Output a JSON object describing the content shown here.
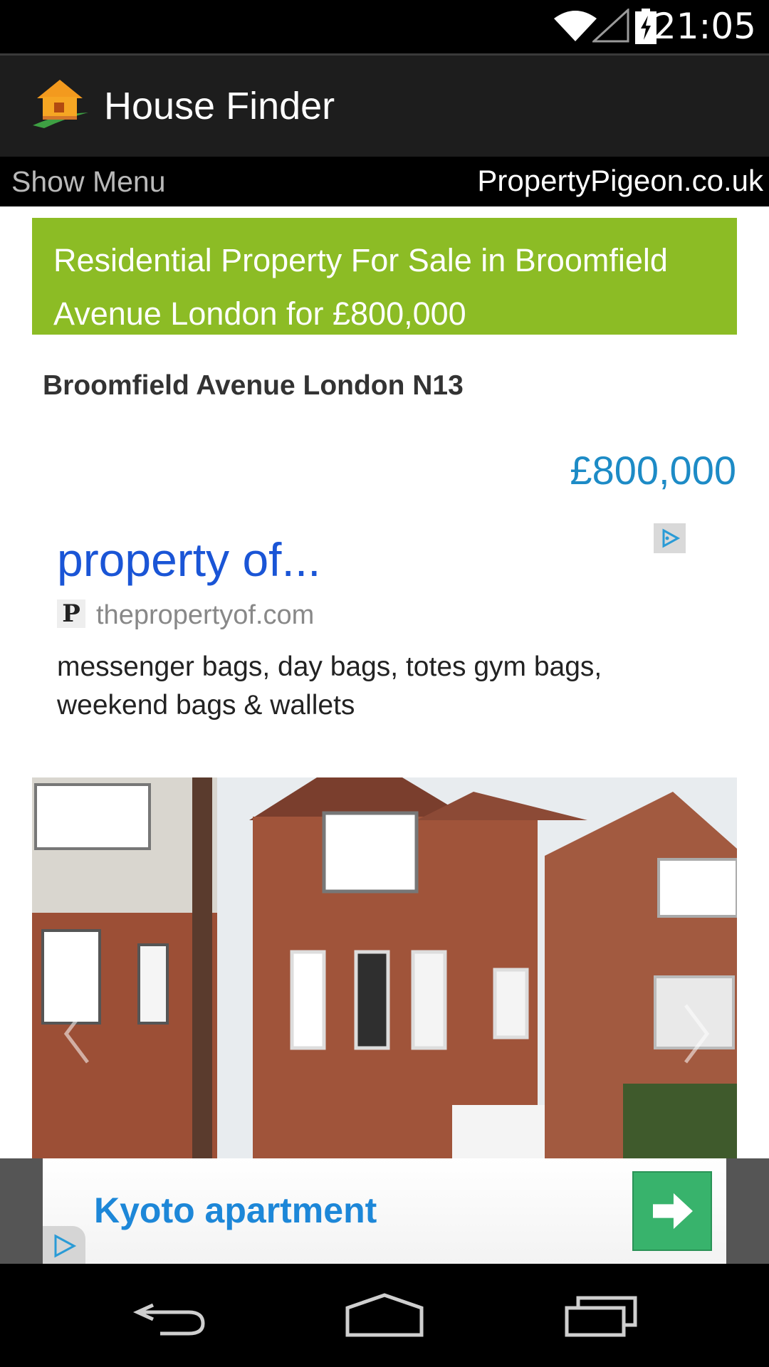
{
  "status_bar": {
    "time": "21:05",
    "icons": [
      "wifi-icon",
      "signal-icon",
      "battery-charging-icon"
    ]
  },
  "action_bar": {
    "title": "House Finder",
    "logo_icon": "house-logo-icon"
  },
  "menu_bar": {
    "show_menu_label": "Show Menu",
    "site_link": "PropertyPigeon.co.uk"
  },
  "listing": {
    "headline": "Residential Property For Sale in Broomfield Avenue London for £800,000",
    "address": "Broomfield Avenue London N13",
    "price": "£800,000",
    "photo_nav_icons": [
      "chevron-left-icon",
      "chevron-right-icon"
    ]
  },
  "ad": {
    "title": "property of...",
    "favicon_letter": "P",
    "domain": "thepropertyof.com",
    "description": "messenger bags, day bags, totes gym bags, weekend bags & wallets",
    "badge_icon": "adchoices-icon"
  },
  "banner_ad": {
    "text": "Kyoto apartment",
    "arrow_icon": "arrow-right-icon",
    "ad_icon": "adchoices-icon"
  },
  "nav_bar": {
    "icons": [
      "back-icon",
      "home-icon",
      "recents-icon"
    ]
  },
  "colors": {
    "headline_bg": "#8cbc25",
    "price": "#1d8bc6",
    "ad_title": "#1a55d6",
    "banner_text": "#1d87d8",
    "banner_button": "#38b36c"
  }
}
